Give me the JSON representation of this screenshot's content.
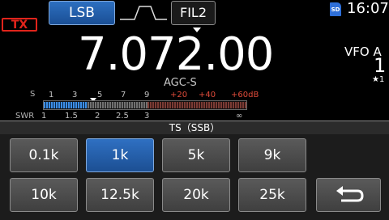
{
  "status": {
    "tx_badge": "TX",
    "mode": "LSB",
    "filter": "FIL2",
    "sd_label": "SD",
    "clock": "16:07"
  },
  "frequency": {
    "display": "7.072.00",
    "agc": "AGC-S"
  },
  "vfo": {
    "label": "VFO A",
    "number": "1",
    "memo": "★1"
  },
  "meter": {
    "s_label": "S",
    "swr_label": "SWR",
    "s_scale": [
      "1",
      "3",
      "5",
      "7",
      "9"
    ],
    "over_scale": [
      "+20",
      "+40",
      "+60dB"
    ],
    "swr_scale": [
      "1",
      "1.5",
      "2",
      "2.5",
      "3",
      "∞"
    ],
    "colors": {
      "fill": "#3c8ee6",
      "over": "#e04b3a"
    }
  },
  "ts_panel": {
    "title": "TS（SSB）",
    "steps": [
      "0.1k",
      "1k",
      "5k",
      "9k",
      "10k",
      "12.5k",
      "20k",
      "25k"
    ],
    "selected": "1k",
    "back_icon": "return-arrow-icon"
  },
  "colors": {
    "accent": "#2f70c2",
    "tx": "#e0241b"
  }
}
